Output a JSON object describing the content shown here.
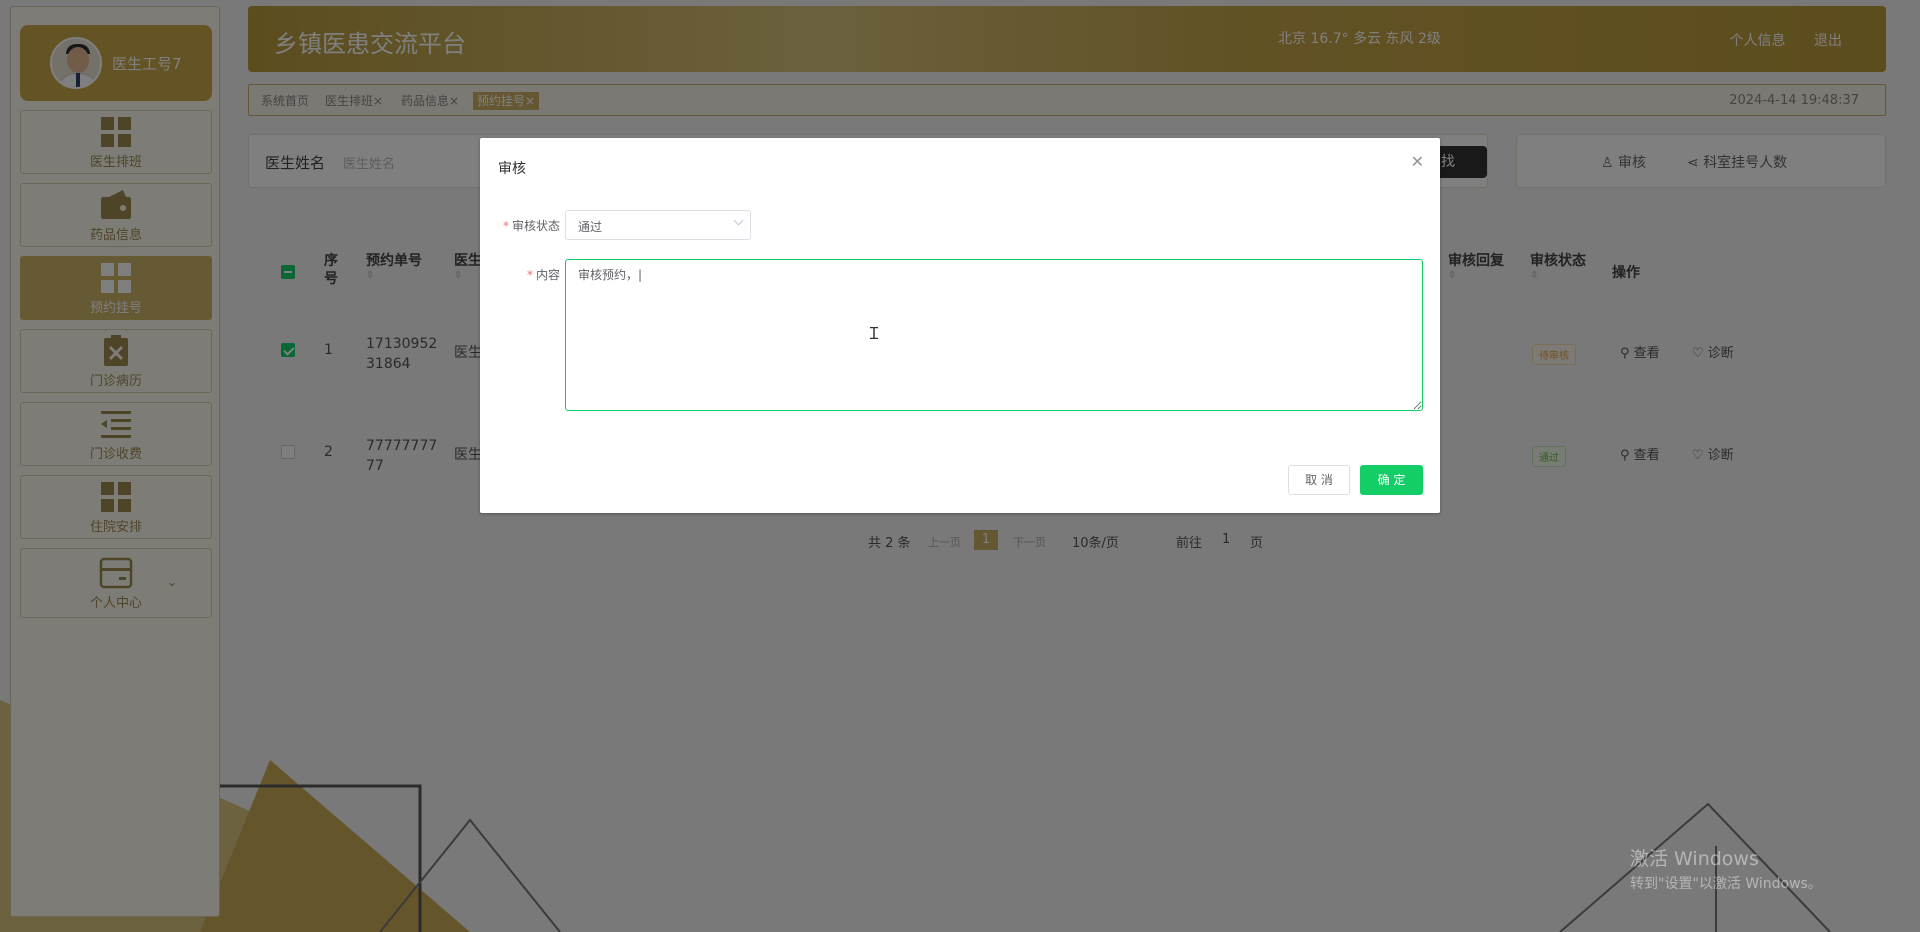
{
  "header": {
    "title": "乡镇医患交流平台",
    "weather": "北京 16.7° 多云 东风 2级",
    "links": [
      "个人信息",
      "退出"
    ]
  },
  "profile": {
    "name": "医生工号7"
  },
  "sidebar": {
    "items": [
      {
        "label": "医生排班",
        "icon": "grid-icon"
      },
      {
        "label": "药品信息",
        "icon": "wallet-icon"
      },
      {
        "label": "预约挂号",
        "icon": "grid-icon",
        "active": true
      },
      {
        "label": "门诊病历",
        "icon": "clipboard-x-icon"
      },
      {
        "label": "门诊收费",
        "icon": "list-indent-icon"
      },
      {
        "label": "住院安排",
        "icon": "grid-icon"
      },
      {
        "label": "个人中心",
        "icon": "card-icon"
      }
    ]
  },
  "tabs": {
    "items": [
      "系统首页",
      "医生排班×",
      "药品信息×",
      "预约挂号×"
    ],
    "datetime": "2024-4-14 19:48:37"
  },
  "search": {
    "label": "医生姓名",
    "placeholder": "医生姓名",
    "button": "找"
  },
  "actions": {
    "review": "审核",
    "dept_count": "科室挂号人数"
  },
  "table": {
    "headers": [
      "序\n号",
      "预约单号",
      "医生",
      "审核回复",
      "审核状态",
      "操作"
    ],
    "rows": [
      {
        "index": "1",
        "order_no_1": "17130952",
        "order_no_2": "31864",
        "doctor": "医生",
        "status": "待审核",
        "view": "查看",
        "diagnose": "诊断"
      },
      {
        "index": "2",
        "order_no_1": "77777777",
        "order_no_2": "77",
        "doctor": "医生",
        "status": "通过",
        "view": "查看",
        "diagnose": "诊断"
      }
    ]
  },
  "pager": {
    "total": "共 2 条",
    "prev": "上一页",
    "current": "1",
    "next": "下一页",
    "size": "10条/页",
    "goto": "前往",
    "goto_value": "1",
    "page_unit": "页"
  },
  "dialog": {
    "title": "审核",
    "status_label": "审核状态",
    "status_value": "通过",
    "content_label": "内容",
    "content_value": "审核预约，|",
    "cancel": "取 消",
    "confirm": "确 定"
  },
  "watermark": {
    "line1": "激活 Windows",
    "line2": "转到\"设置\"以激活 Windows。"
  },
  "colors": {
    "brand": "#c8ae62",
    "primary": "#13ce66"
  }
}
